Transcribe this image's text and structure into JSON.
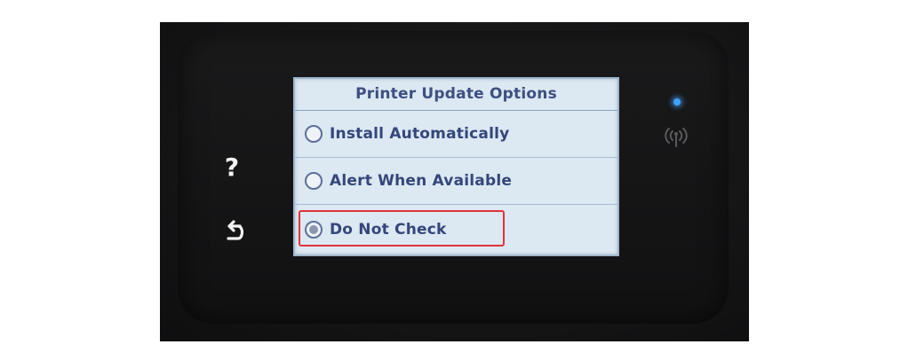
{
  "device": {
    "help_symbol": "?",
    "back_icon": "back-arrow-icon",
    "wifi_icon": "wireless-signal-icon",
    "led_color": "#3fa2ff"
  },
  "screen": {
    "title": "Printer Update Options",
    "options": [
      {
        "label": "Install Automatically",
        "selected": false
      },
      {
        "label": "Alert When Available",
        "selected": false
      },
      {
        "label": "Do Not Check",
        "selected": true
      }
    ],
    "highlight_color": "#e0323b"
  }
}
